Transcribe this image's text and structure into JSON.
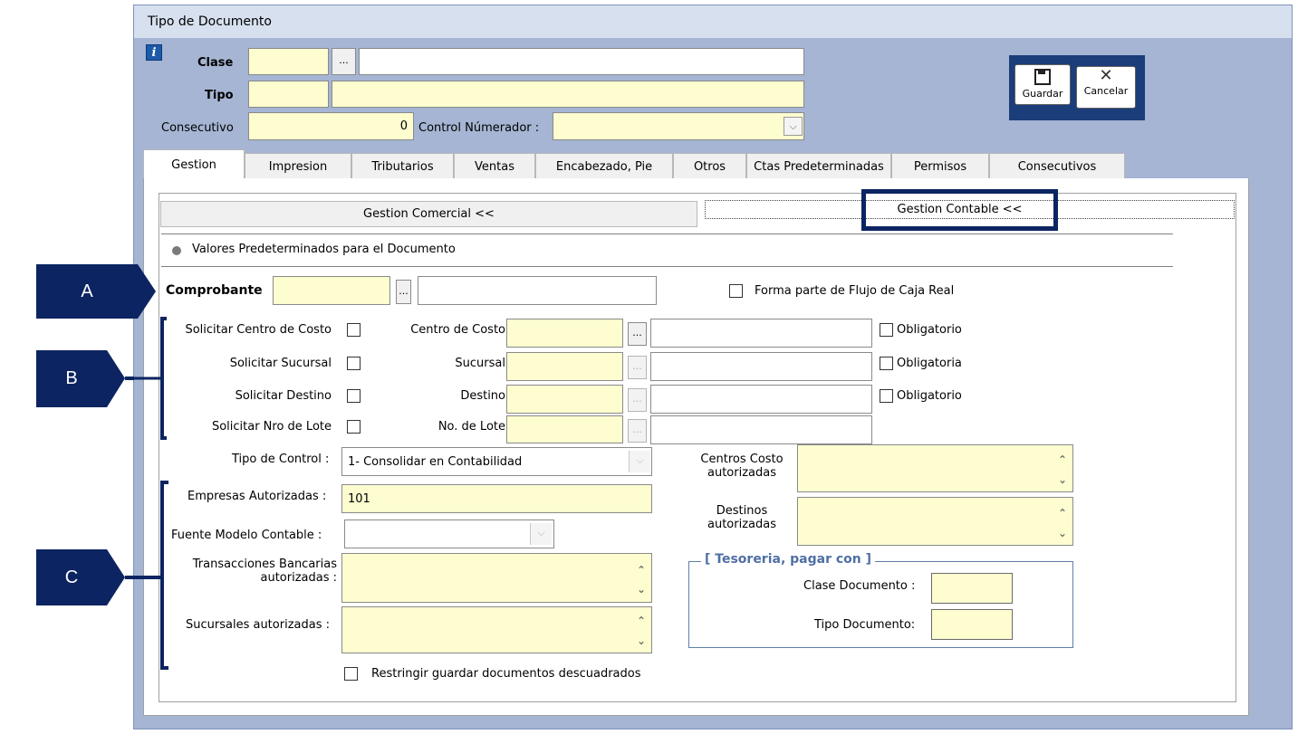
{
  "window": {
    "title": "Tipo de Documento"
  },
  "header": {
    "clase_label": "Clase",
    "tipo_label": "Tipo",
    "consecutivo_label": "Consecutivo",
    "consecutivo_value": "0",
    "control_numerador_label": "Control Númerador :",
    "dots": "..."
  },
  "toolbar": {
    "save_label": "Guardar",
    "cancel_label": "Cancelar"
  },
  "tabs": [
    "Gestion",
    "Impresion",
    "Tributarios",
    "Ventas",
    "Encabezado, Pie",
    "Otros",
    "Ctas Predeterminadas",
    "Permisos",
    "Consecutivos"
  ],
  "subtabs": {
    "comercial": "Gestion Comercial <<",
    "contable": "Gestion Contable <<"
  },
  "section": {
    "title": "Valores Predeterminados para el Documento"
  },
  "comprobante": {
    "label": "Comprobante",
    "flujo_caja_label": "Forma parte de Flujo de Caja  Real"
  },
  "rows": [
    {
      "solicitar": "Solicitar Centro de Costo",
      "field": "Centro de Costo",
      "obligatorio": "Obligatorio"
    },
    {
      "solicitar": "Solicitar Sucursal",
      "field": "Sucursal",
      "obligatorio": "Obligatoria"
    },
    {
      "solicitar": "Solicitar Destino",
      "field": "Destino",
      "obligatorio": "Obligatorio"
    },
    {
      "solicitar": "Solicitar Nro de  Lote",
      "field": "No. de Lote"
    }
  ],
  "tipo_control": {
    "label": "Tipo de Control :",
    "value": "1- Consolidar en Contabilidad"
  },
  "empresas": {
    "label": "Empresas Autorizadas :",
    "value": "101"
  },
  "fuente_modelo": {
    "label": "Fuente Modelo Contable :"
  },
  "transacciones": {
    "label_line1": "Transacciones Bancarias",
    "label_line2": "autorizadas :"
  },
  "sucursales": {
    "label": "Sucursales autorizadas :"
  },
  "restringir": {
    "label": "Restringir guardar documentos descuadrados"
  },
  "centros_costo": {
    "label_line1": "Centros Costo",
    "label_line2": "autorizadas"
  },
  "destinos": {
    "label_line1": "Destinos",
    "label_line2": "autorizadas"
  },
  "tesoreria": {
    "title": "[ Tesoreria, pagar con ]",
    "clase_label": "Clase Documento :",
    "tipo_label": "Tipo Documento:"
  },
  "annotations": {
    "a": "A",
    "b": "B",
    "c": "C"
  },
  "colors": {
    "badge": "#0c2461",
    "window_bg": "#a5b5d3",
    "field_yellow": "#fdfdd0",
    "groupbox_title": "#4f6fa5"
  },
  "icons": [
    "info-icon",
    "floppy-save-icon",
    "cancel-x-icon",
    "chevron-down-icon",
    "scroll-up-icon",
    "scroll-down-icon"
  ]
}
